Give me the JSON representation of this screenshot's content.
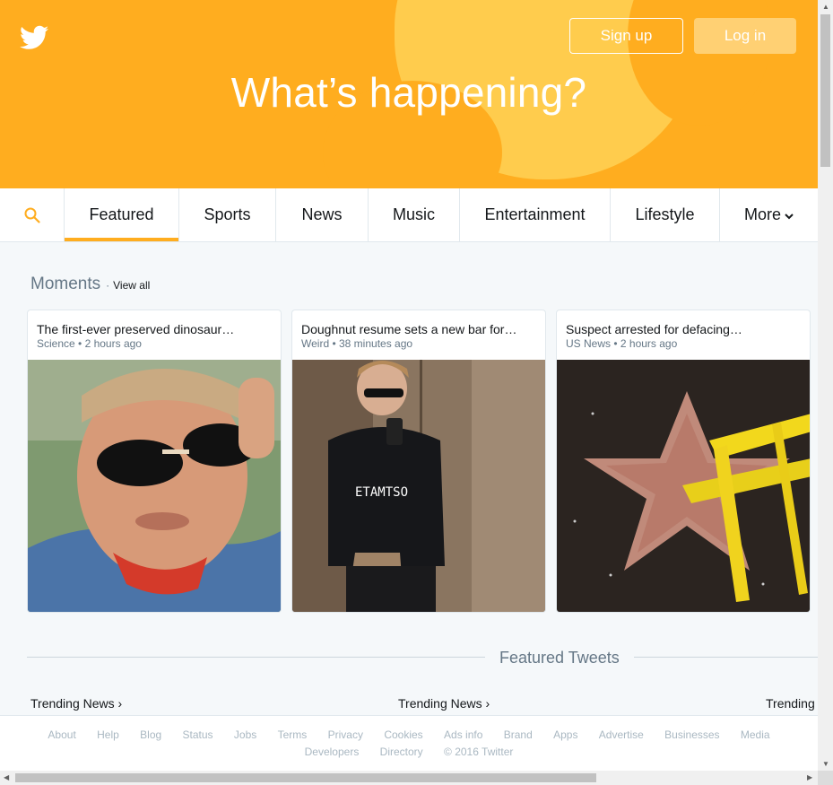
{
  "header": {
    "title": "What’s happening?",
    "signup_label": "Sign up",
    "login_label": "Log in",
    "logo_icon": "twitter-bird-icon"
  },
  "nav": {
    "search_icon": "search-icon",
    "tabs": [
      {
        "label": "Featured",
        "active": true
      },
      {
        "label": "Sports"
      },
      {
        "label": "News"
      },
      {
        "label": "Music"
      },
      {
        "label": "Entertainment"
      },
      {
        "label": "Lifestyle"
      },
      {
        "label": "More"
      }
    ]
  },
  "moments": {
    "title": "Moments",
    "separator": "·",
    "view_all": "View all",
    "cards": [
      {
        "title": "The first-ever preserved dinosaur…",
        "category": "Science",
        "time": "2 hours ago"
      },
      {
        "title": "Doughnut resume sets a new bar for…",
        "category": "Weird",
        "time": "38 minutes ago"
      },
      {
        "title": "Suspect arrested for defacing…",
        "category": "US News",
        "time": "2 hours ago"
      }
    ]
  },
  "featured_tweets": {
    "title": "Featured Tweets",
    "trending": [
      "Trending News",
      "Trending News",
      "Trending N"
    ]
  },
  "footer": {
    "row1": [
      "About",
      "Help",
      "Blog",
      "Status",
      "Jobs",
      "Terms",
      "Privacy",
      "Cookies",
      "Ads info",
      "Brand",
      "Apps",
      "Advertise",
      "Businesses",
      "Media"
    ],
    "row2": [
      "Developers",
      "Directory",
      "© 2016 Twitter"
    ]
  },
  "colors": {
    "brand_orange": "#ffad1f",
    "accent_yellow": "#ffcc4d",
    "muted_text": "#657786",
    "footer_text": "#aab8c2"
  }
}
